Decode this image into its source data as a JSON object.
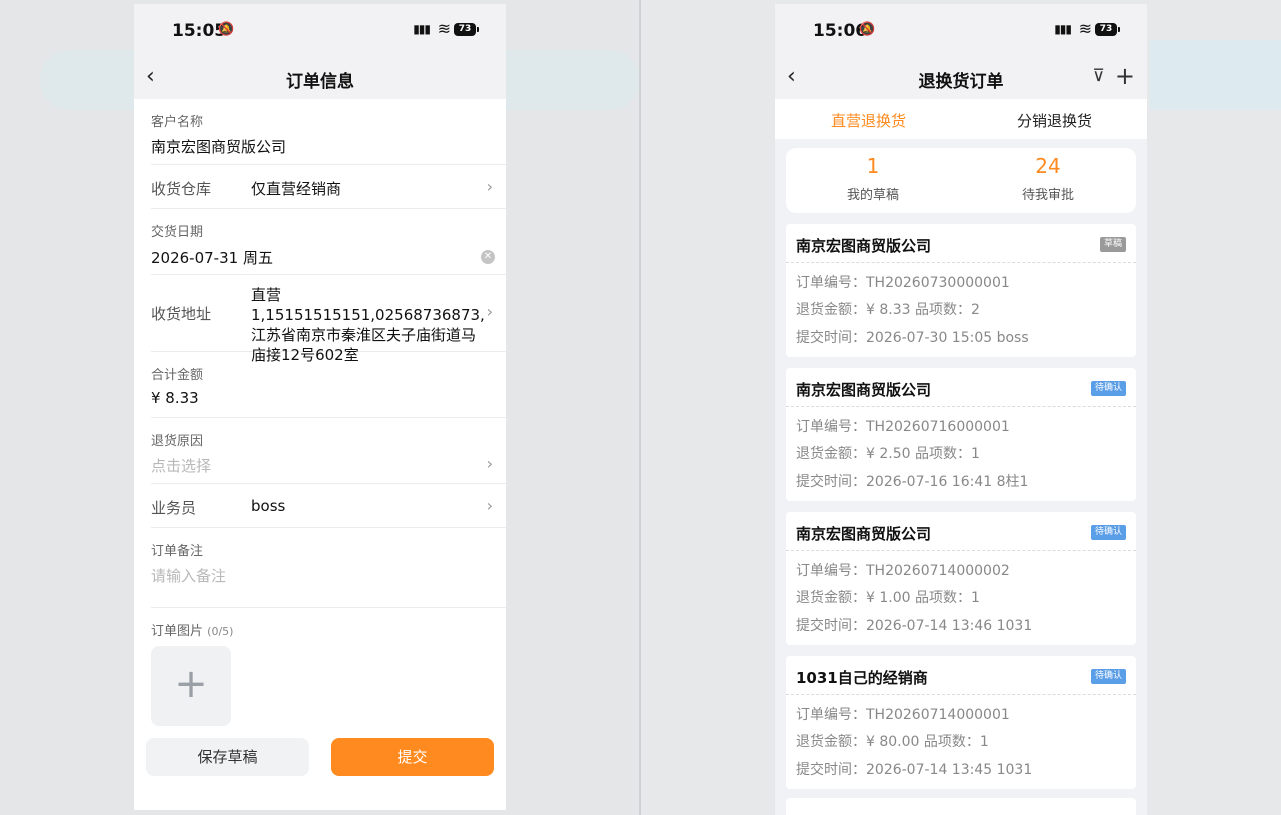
{
  "left": {
    "status": {
      "time": "15:05",
      "battery": "73"
    },
    "nav": {
      "title": "订单信息"
    },
    "form": {
      "customer": {
        "label": "客户名称",
        "value": "南京宏图商贸版公司"
      },
      "warehouse": {
        "label": "收货仓库",
        "value": "仅直营经销商"
      },
      "delivery_date": {
        "label": "交货日期",
        "value": "2026-07-31 周五"
      },
      "address": {
        "label": "收货地址",
        "value": "直营1,15151515151,02568736873,江苏省南京市秦淮区夫子庙街道马庙接12号602室"
      },
      "total": {
        "label": "合计金额",
        "value": "¥ 8.33"
      },
      "reason": {
        "label": "退货原因",
        "placeholder": "点击选择"
      },
      "salesman": {
        "label": "业务员",
        "value": "boss"
      },
      "remark": {
        "label": "订单备注",
        "placeholder": "请输入备注"
      },
      "images": {
        "label": "订单图片",
        "count": "(0/5)"
      }
    },
    "buttons": {
      "draft": "保存草稿",
      "submit": "提交"
    }
  },
  "right": {
    "status": {
      "time": "15:06",
      "battery": "73"
    },
    "nav": {
      "title": "退换货订单"
    },
    "tabs": [
      "直营退换货",
      "分销退换货"
    ],
    "stats": [
      {
        "value": "1",
        "label": "我的草稿"
      },
      {
        "value": "24",
        "label": "待我审批"
      }
    ],
    "orders": [
      {
        "customer": "南京宏图商贸版公司",
        "badge": "草稿",
        "order_no": "订单编号：TH20260730000001",
        "amount": "退货金额：¥ 8.33   品项数：2",
        "submitted": "提交时间：2026-07-30 15:05  boss"
      },
      {
        "customer": "南京宏图商贸版公司",
        "badge": "待确认",
        "order_no": "订单编号：TH20260716000001",
        "amount": "退货金额：¥ 2.50   品项数：1",
        "submitted": "提交时间：2026-07-16 16:41  8柱1"
      },
      {
        "customer": "南京宏图商贸版公司",
        "badge": "待确认",
        "order_no": "订单编号：TH20260714000002",
        "amount": "退货金额：¥ 1.00   品项数：1",
        "submitted": "提交时间：2026-07-14 13:46  1031"
      },
      {
        "customer": "1031自己的经销商",
        "badge": "待确认",
        "order_no": "订单编号：TH20260714000001",
        "amount": "退货金额：¥ 80.00   品项数：1",
        "submitted": "提交时间：2026-07-14 13:45  1031"
      }
    ]
  },
  "colors": {
    "accent": "#ff8a1f",
    "badge_pending": "#5b9ee8",
    "badge_draft": "#9a9a9a"
  }
}
